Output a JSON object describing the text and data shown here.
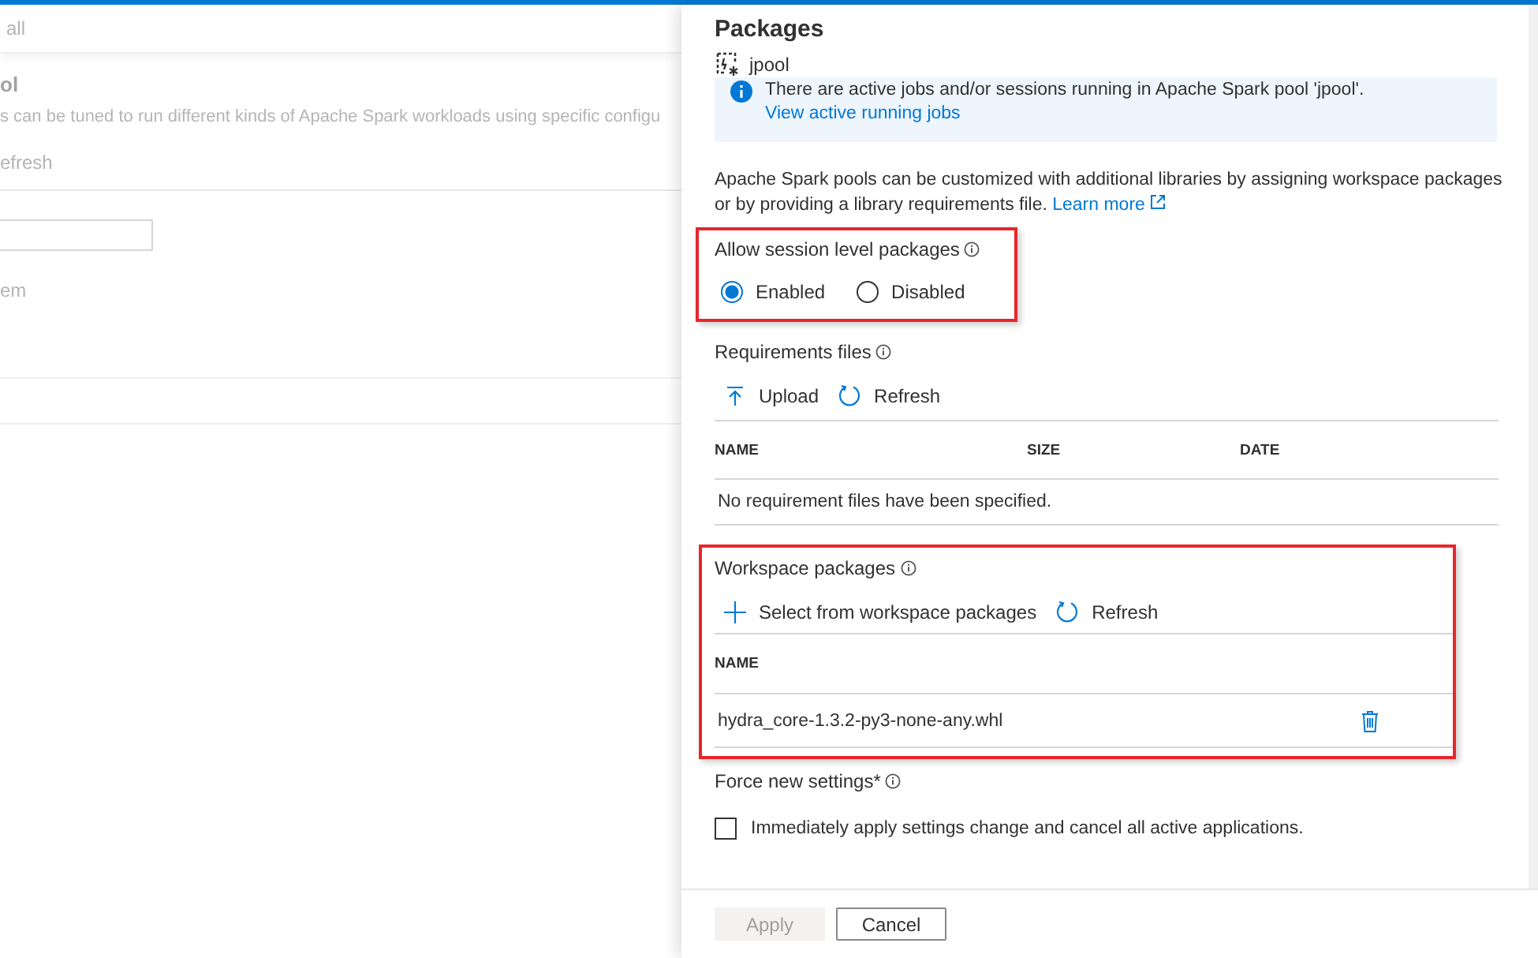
{
  "background": {
    "breadcrumb": "all",
    "title": "ol",
    "description": "s can be tuned to run different kinds of Apache Spark workloads using specific configu",
    "refresh": "efresh",
    "item": "em"
  },
  "panel": {
    "title": "Packages",
    "pool": "jpool",
    "banner": {
      "text": "There are active jobs and/or sessions running in Apache Spark pool 'jpool'.",
      "link": "View active running jobs"
    },
    "description": {
      "text": "Apache Spark pools can be customized with additional libraries by assigning workspace packages or by providing a library requirements file.",
      "link": "Learn more"
    },
    "session_packages": {
      "label": "Allow session level packages",
      "options": [
        {
          "label": "Enabled",
          "selected": true
        },
        {
          "label": "Disabled",
          "selected": false
        }
      ]
    },
    "requirements": {
      "label": "Requirements files",
      "toolbar": [
        {
          "kind": "upload",
          "label": "Upload"
        },
        {
          "kind": "refresh",
          "label": "Refresh"
        }
      ],
      "columns": [
        "NAME",
        "SIZE",
        "DATE"
      ],
      "empty": "No requirement files have been specified."
    },
    "workspace": {
      "label": "Workspace packages",
      "toolbar": [
        {
          "kind": "add",
          "label": "Select from workspace packages"
        },
        {
          "kind": "refresh",
          "label": "Refresh"
        }
      ],
      "columns": [
        "NAME"
      ],
      "rows": [
        {
          "name": "hydra_core-1.3.2-py3-none-any.whl"
        }
      ]
    },
    "force": {
      "label": "Force new settings*",
      "checkbox_label": "Immediately apply settings change and cancel all active applications.",
      "checked": false
    },
    "buttons": [
      {
        "label": "Apply",
        "disabled": true
      },
      {
        "label": "Cancel",
        "disabled": false
      }
    ]
  }
}
